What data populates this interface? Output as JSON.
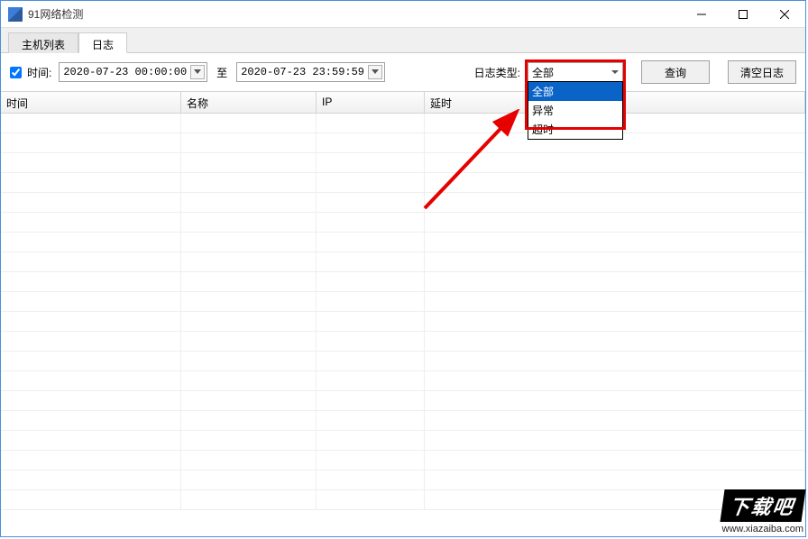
{
  "window": {
    "title": "91网络检测"
  },
  "tabs": {
    "items": [
      {
        "label": "主机列表"
      },
      {
        "label": "日志"
      }
    ],
    "active_index": 1
  },
  "toolbar": {
    "time_checkbox_checked": true,
    "time_label": "时间:",
    "date_from": "2020-07-23 00:00:00",
    "to_label": "至",
    "date_to": "2020-07-23 23:59:59",
    "logtype_label": "日志类型:",
    "logtype_selected": "全部",
    "logtype_options": [
      {
        "label": "全部",
        "selected": true
      },
      {
        "label": "异常",
        "selected": false
      },
      {
        "label": "超时",
        "selected": false
      }
    ],
    "query_btn": "查询",
    "clear_btn": "清空日志"
  },
  "grid": {
    "columns": [
      {
        "label": "时间"
      },
      {
        "label": "名称"
      },
      {
        "label": "IP"
      },
      {
        "label": "延时"
      }
    ]
  },
  "annotation": {
    "highlight_color": "#e60000",
    "arrow_color": "#e60000"
  },
  "watermark": {
    "logo_text": "下载吧",
    "url": "www.xiazaiba.com"
  }
}
